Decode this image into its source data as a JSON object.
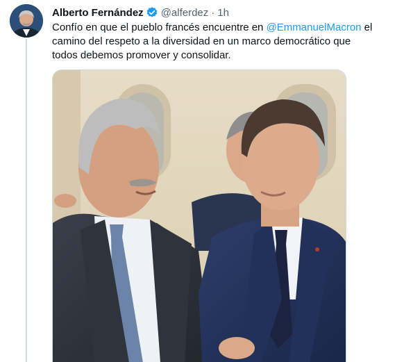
{
  "tweet": {
    "author_name": "Alberto Fernández",
    "verified_icon": "verified-badge-icon",
    "handle": "@alferdez",
    "separator": "·",
    "time": "1h",
    "text_before": "Confío en que el pueblo francés encuentre en ",
    "mention": "@EmmanuelMacron",
    "text_after": " el camino del respeto a la diversidad en un marco democrático que todos debemos promover y consolidar."
  },
  "colors": {
    "link": "#1d9bf0",
    "verified": "#1d9bf0",
    "secondary_text": "#536471",
    "thread_line": "#cfd9de"
  },
  "media": {
    "kind": "photo"
  }
}
